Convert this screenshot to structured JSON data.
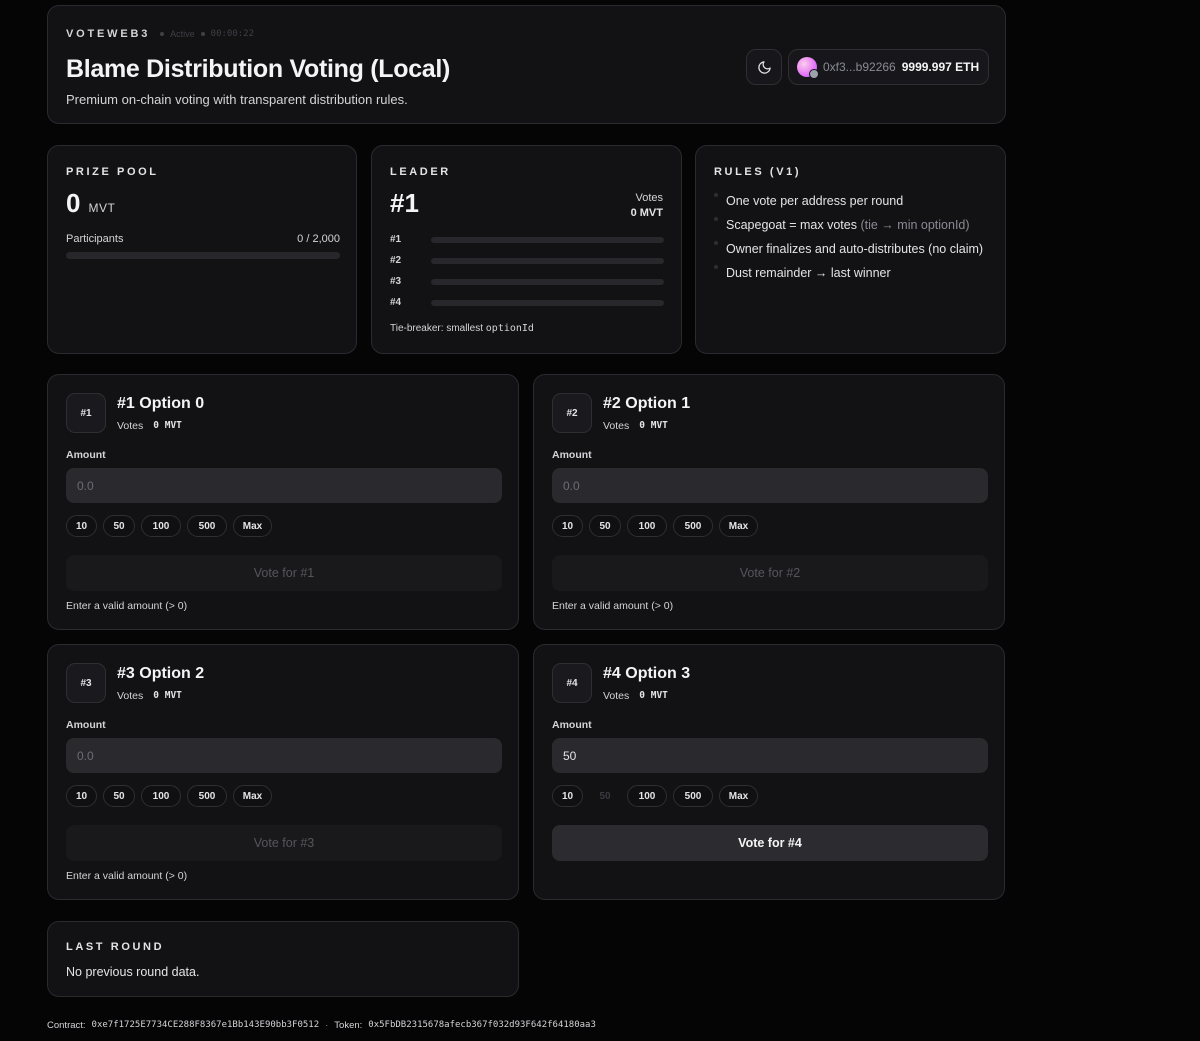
{
  "header": {
    "brand": "VOTEWEB3",
    "status": "Active",
    "timer": "00:00:22",
    "title": "Blame Distribution Voting (Local)",
    "subtitle": "Premium on-chain voting with transparent distribution rules.",
    "theme_icon": "moon-icon",
    "wallet": {
      "address": "0xf3...b92266",
      "balance": "9999.997 ETH"
    }
  },
  "prize_pool": {
    "label": "PRIZE POOL",
    "amount": "0",
    "unit": "MVT",
    "participants_label": "Participants",
    "participants_value": "0 / 2,000",
    "participants_fraction": 0
  },
  "leader": {
    "label": "LEADER",
    "id": "#1",
    "votes_label": "Votes",
    "votes_value": "0 MVT",
    "ranks": [
      {
        "label": "#1",
        "fraction": 0
      },
      {
        "label": "#2",
        "fraction": 0
      },
      {
        "label": "#3",
        "fraction": 0
      },
      {
        "label": "#4",
        "fraction": 0
      }
    ],
    "tie_breaker_prefix": "Tie-breaker: smallest ",
    "tie_breaker_code": "optionId"
  },
  "rules": {
    "label": "RULES (V1)",
    "items": [
      {
        "text": "One vote per address per round",
        "dim": ""
      },
      {
        "text": "Scapegoat = max votes ",
        "dim": "(tie → min optionId)"
      },
      {
        "text": "Owner finalizes and auto-distributes (no claim)",
        "dim": ""
      },
      {
        "text": "Dust remainder → last winner",
        "dim": ""
      }
    ]
  },
  "options": [
    {
      "badge": "#1",
      "title": "#1 Option 0",
      "votes_label": "Votes",
      "votes_value": "0 MVT",
      "amount_label": "Amount",
      "value": "",
      "placeholder": "0.0",
      "presets": [
        "10",
        "50",
        "100",
        "500",
        "Max"
      ],
      "vote_label": "Vote for #1",
      "hint": "Enter a valid amount (> 0)"
    },
    {
      "badge": "#2",
      "title": "#2 Option 1",
      "votes_label": "Votes",
      "votes_value": "0 MVT",
      "amount_label": "Amount",
      "value": "",
      "placeholder": "0.0",
      "presets": [
        "10",
        "50",
        "100",
        "500",
        "Max"
      ],
      "vote_label": "Vote for #2",
      "hint": "Enter a valid amount (> 0)"
    },
    {
      "badge": "#3",
      "title": "#3 Option 2",
      "votes_label": "Votes",
      "votes_value": "0 MVT",
      "amount_label": "Amount",
      "value": "",
      "placeholder": "0.0",
      "presets": [
        "10",
        "50",
        "100",
        "500",
        "Max"
      ],
      "vote_label": "Vote for #3",
      "hint": "Enter a valid amount (> 0)"
    },
    {
      "badge": "#4",
      "title": "#4 Option 3",
      "votes_label": "Votes",
      "votes_value": "0 MVT",
      "amount_label": "Amount",
      "value": "50",
      "placeholder": "0.0",
      "presets": [
        "10",
        "50",
        "100",
        "500",
        "Max"
      ],
      "vote_label": "Vote for #4",
      "hint": ""
    }
  ],
  "last_round": {
    "label": "LAST ROUND",
    "message": "No previous round data."
  },
  "footer": {
    "contract_label": "Contract:",
    "contract_address": "0xe7f1725E7734CE288F8367e1Bb143E90bb3F0512",
    "separator": "·",
    "token_label": "Token:",
    "token_address": "0x5FbDB2315678afecb367f032d93F642f64180aa3"
  }
}
